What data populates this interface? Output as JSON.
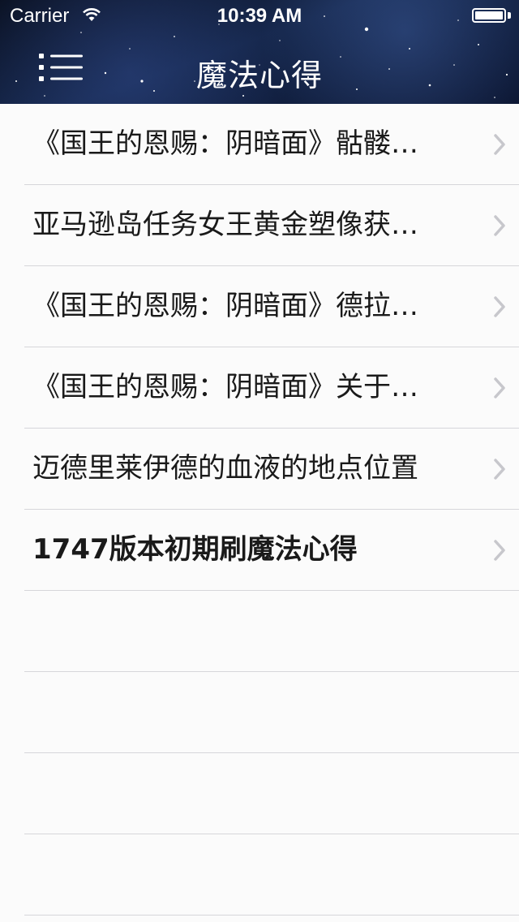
{
  "status_bar": {
    "carrier": "Carrier",
    "time": "10:39 AM",
    "wifi_icon": "wifi-icon",
    "battery_icon": "battery-icon"
  },
  "nav": {
    "title": "魔法心得",
    "menu_icon": "menu-icon"
  },
  "list": {
    "items": [
      {
        "label": "《国王的恩赐：阴暗面》骷髅…"
      },
      {
        "label": "亚马逊岛任务女王黄金塑像获…"
      },
      {
        "label": "《国王的恩赐：阴暗面》德拉…"
      },
      {
        "label": "《国王的恩赐：阴暗面》关于…"
      },
      {
        "label": "迈德里莱伊德的血液的地点位置"
      },
      {
        "label": "1747版本初期刷魔法心得"
      }
    ],
    "chevron_icon": "chevron-right-icon"
  },
  "colors": {
    "header_bg": "#15264a",
    "separator": "#d6d6da",
    "chevron": "#c7c7cc",
    "text": "#1a1a1a"
  }
}
